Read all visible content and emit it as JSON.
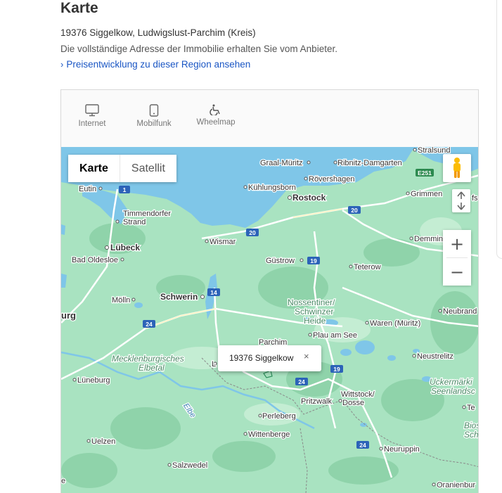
{
  "section": {
    "title": "Karte",
    "address": "19376 Siggelkow, Ludwigslust-Parchim (Kreis)",
    "address_note": "Die vollständige Adresse der Immobilie erhalten Sie vom Anbieter.",
    "price_link": "Preisentwicklung zu dieser Region ansehen"
  },
  "tabs": [
    {
      "label": "Internet",
      "icon": "monitor-icon"
    },
    {
      "label": "Mobilfunk",
      "icon": "phone-icon"
    },
    {
      "label": "Wheelmap",
      "icon": "wheelchair-icon"
    }
  ],
  "map": {
    "type_buttons": {
      "map": "Karte",
      "satellite": "Satellit"
    },
    "zoom_in": "+",
    "zoom_out": "−",
    "info_window": {
      "text": "19376 Siggelkow",
      "close": "×"
    },
    "labels": {
      "stralsund": "Stralsund",
      "graal_mueritz": "Graal-Müritz",
      "ribnitz": "Ribnitz-Damgarten",
      "roevershagen": "Rövershagen",
      "kuehlungsborn": "Kühlungsborn",
      "rostock": "Rostock",
      "grimmen": "Grimmen",
      "grimmen_tail": "fs",
      "eutin": "Eutin",
      "timmendorfer": "Timmendorfer",
      "strand": "Strand",
      "luebeck": "Lübeck",
      "wismar": "Wismar",
      "demmin": "Demmin",
      "bad_oldesloe": "Bad Oldesloe",
      "guestrow": "Güstrow",
      "teterow": "Teterow",
      "schwerin": "Schwerin",
      "moelln": "Mölln",
      "nossentiner1": "Nossentiner/",
      "nossentiner2": "Schwinzer",
      "nossentiner3": "Heide",
      "neubrand": "Neubrand",
      "waren": "Waren (Müritz)",
      "plau": "Plau am See",
      "hamburg_tail": "urg",
      "parchim": "Parchim",
      "mecklenburgisches": "Mecklenburgisches",
      "elbetal": "Elbetal",
      "neustrelitz": "Neustrelitz",
      "lueneburg": "Lüneburg",
      "wittstock": "Wittstock/",
      "dosse": "Dosse",
      "pritzwalk": "Pritzwalk",
      "uckermark1": "Uckermärki",
      "uckermark2": "Seenlandsc",
      "elbe": "Elbe",
      "perleberg": "Perleberg",
      "te_tail": "Te",
      "wittenberge": "Wittenberge",
      "bio_tail1": "Bios",
      "bio_tail2": "Sch",
      "uelzen": "Uelzen",
      "neuruppin": "Neuruppin",
      "salzwedel": "Salzwedel",
      "oranienburg": "Oranienbur",
      "e_tail": "e",
      "l_tail": "L"
    },
    "roads": {
      "r1": "1",
      "r20a": "20",
      "r20b": "20",
      "r19a": "19",
      "r19b": "19",
      "r14": "14",
      "r24a": "24",
      "r24b": "24",
      "r24c": "24",
      "e251": "E251"
    }
  }
}
